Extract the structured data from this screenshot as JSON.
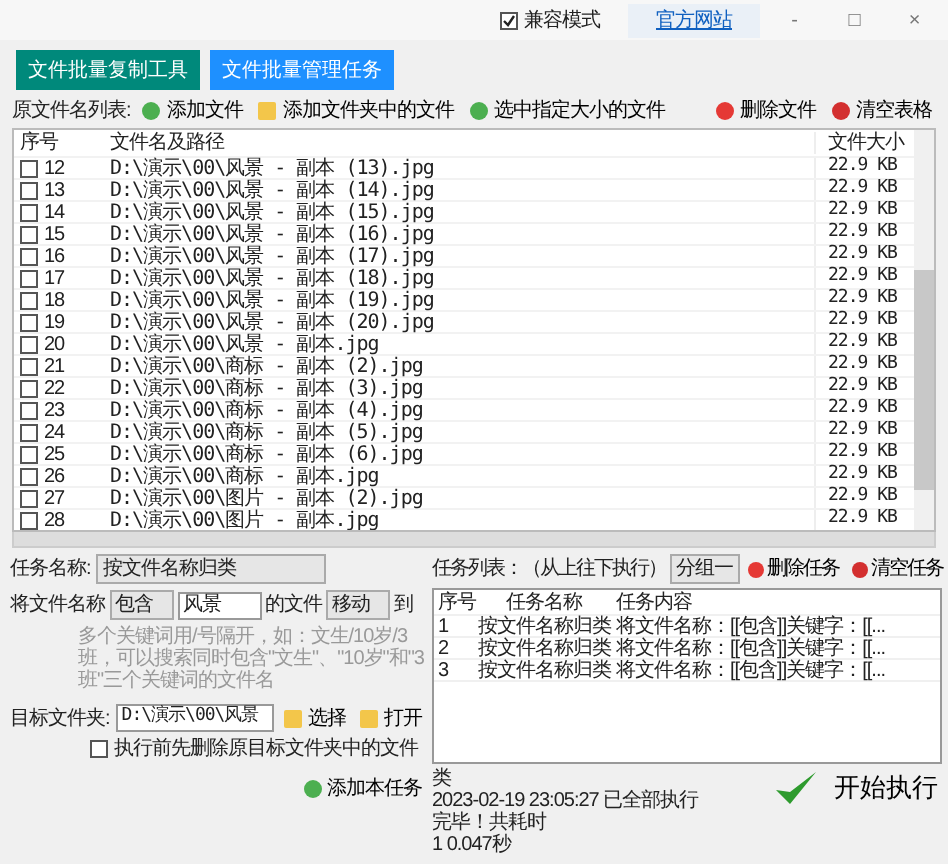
{
  "title_bar": {
    "compat_mode": {
      "label": "兼容模式",
      "checked": true
    },
    "website_link": "官方网站",
    "controls": [
      "-",
      "□",
      "×"
    ]
  },
  "tabs": [
    {
      "label": "文件批量复制工具",
      "selected": false
    },
    {
      "label": "文件批量管理任务",
      "selected": true
    }
  ],
  "file_toolbar": {
    "label": "原文件名列表:",
    "buttons": [
      {
        "label": "添加文件"
      },
      {
        "label": "添加文件夹中的文件"
      },
      {
        "label": "选中指定大小的文件"
      },
      {
        "label": "删除文件"
      },
      {
        "label": "清空表格"
      }
    ]
  },
  "file_table": {
    "columns": [
      "序号",
      "文件名及路径",
      "文件大小"
    ],
    "rows": [
      {
        "index": "12",
        "path": "D:\\演示\\00\\风景 - 副本 (13).jpg",
        "size": "22.9 KB",
        "checked": false
      },
      {
        "index": "13",
        "path": "D:\\演示\\00\\风景 - 副本 (14).jpg",
        "size": "22.9 KB",
        "checked": false
      },
      {
        "index": "14",
        "path": "D:\\演示\\00\\风景 - 副本 (15).jpg",
        "size": "22.9 KB",
        "checked": false
      },
      {
        "index": "15",
        "path": "D:\\演示\\00\\风景 - 副本 (16).jpg",
        "size": "22.9 KB",
        "checked": false
      },
      {
        "index": "16",
        "path": "D:\\演示\\00\\风景 - 副本 (17).jpg",
        "size": "22.9 KB",
        "checked": false
      },
      {
        "index": "17",
        "path": "D:\\演示\\00\\风景 - 副本 (18).jpg",
        "size": "22.9 KB",
        "checked": false
      },
      {
        "index": "18",
        "path": "D:\\演示\\00\\风景 - 副本 (19).jpg",
        "size": "22.9 KB",
        "checked": false
      },
      {
        "index": "19",
        "path": "D:\\演示\\00\\风景 - 副本 (20).jpg",
        "size": "22.9 KB",
        "checked": false
      },
      {
        "index": "20",
        "path": "D:\\演示\\00\\风景 - 副本.jpg",
        "size": "22.9 KB",
        "checked": false
      },
      {
        "index": "21",
        "path": "D:\\演示\\00\\商标 - 副本 (2).jpg",
        "size": "22.9 KB",
        "checked": false
      },
      {
        "index": "22",
        "path": "D:\\演示\\00\\商标 - 副本 (3).jpg",
        "size": "22.9 KB",
        "checked": false
      },
      {
        "index": "23",
        "path": "D:\\演示\\00\\商标 - 副本 (4).jpg",
        "size": "22.9 KB",
        "checked": false
      },
      {
        "index": "24",
        "path": "D:\\演示\\00\\商标 - 副本 (5).jpg",
        "size": "22.9 KB",
        "checked": false
      },
      {
        "index": "25",
        "path": "D:\\演示\\00\\商标 - 副本 (6).jpg",
        "size": "22.9 KB",
        "checked": false
      },
      {
        "index": "26",
        "path": "D:\\演示\\00\\商标 - 副本.jpg",
        "size": "22.9 KB",
        "checked": false
      },
      {
        "index": "27",
        "path": "D:\\演示\\00\\图片 - 副本 (2).jpg",
        "size": "22.9 KB",
        "checked": false
      },
      {
        "index": "28",
        "path": "D:\\演示\\00\\图片 - 副本.jpg",
        "size": "22.9 KB",
        "checked": false
      }
    ]
  },
  "task_form": {
    "task_name_label": "任务名称:",
    "task_name": "按文件名称归类",
    "rule_label": "将文件名称",
    "match_mode": "包含",
    "keyword": "风景",
    "file_label": "的文件",
    "action": "移动",
    "to_label": "到",
    "hint": "多个关键词用/号隔开，如：文生/10岁/3班，可以搜索同时包含\"文生\"、\"10岁\"和\"3班\"三个关键词的文件名",
    "target_label": "目标文件夹:",
    "target": "D:\\演示\\00\\风景",
    "choose_button": "选择",
    "open_button": "打开",
    "clear_target": {
      "label": "执行前先删除原目标文件夹中的文件",
      "checked": false
    },
    "add_button": "添加本任务"
  },
  "task_list": {
    "label": "任务列表：（从上往下执行）",
    "group": "分组一",
    "delete_button": "删除任务",
    "clear_button": "清空任务",
    "columns": [
      "序号",
      "任务名称",
      "任务内容"
    ],
    "rows": [
      {
        "index": "1",
        "name": "按文件名称归类",
        "content": "将文件名称：[[包含]]关键字：[[..."
      },
      {
        "index": "2",
        "name": "按文件名称归类",
        "content": "将文件名称：[[包含]]关键字：[[..."
      },
      {
        "index": "3",
        "name": "按文件名称归类",
        "content": "将文件名称：[[包含]]关键字：[[..."
      }
    ]
  },
  "log": [
    "类",
    "2023-02-19 23:05:27 已全部执行完毕！共耗时",
    "1 0.047秒"
  ],
  "start_button": "开始执行"
}
